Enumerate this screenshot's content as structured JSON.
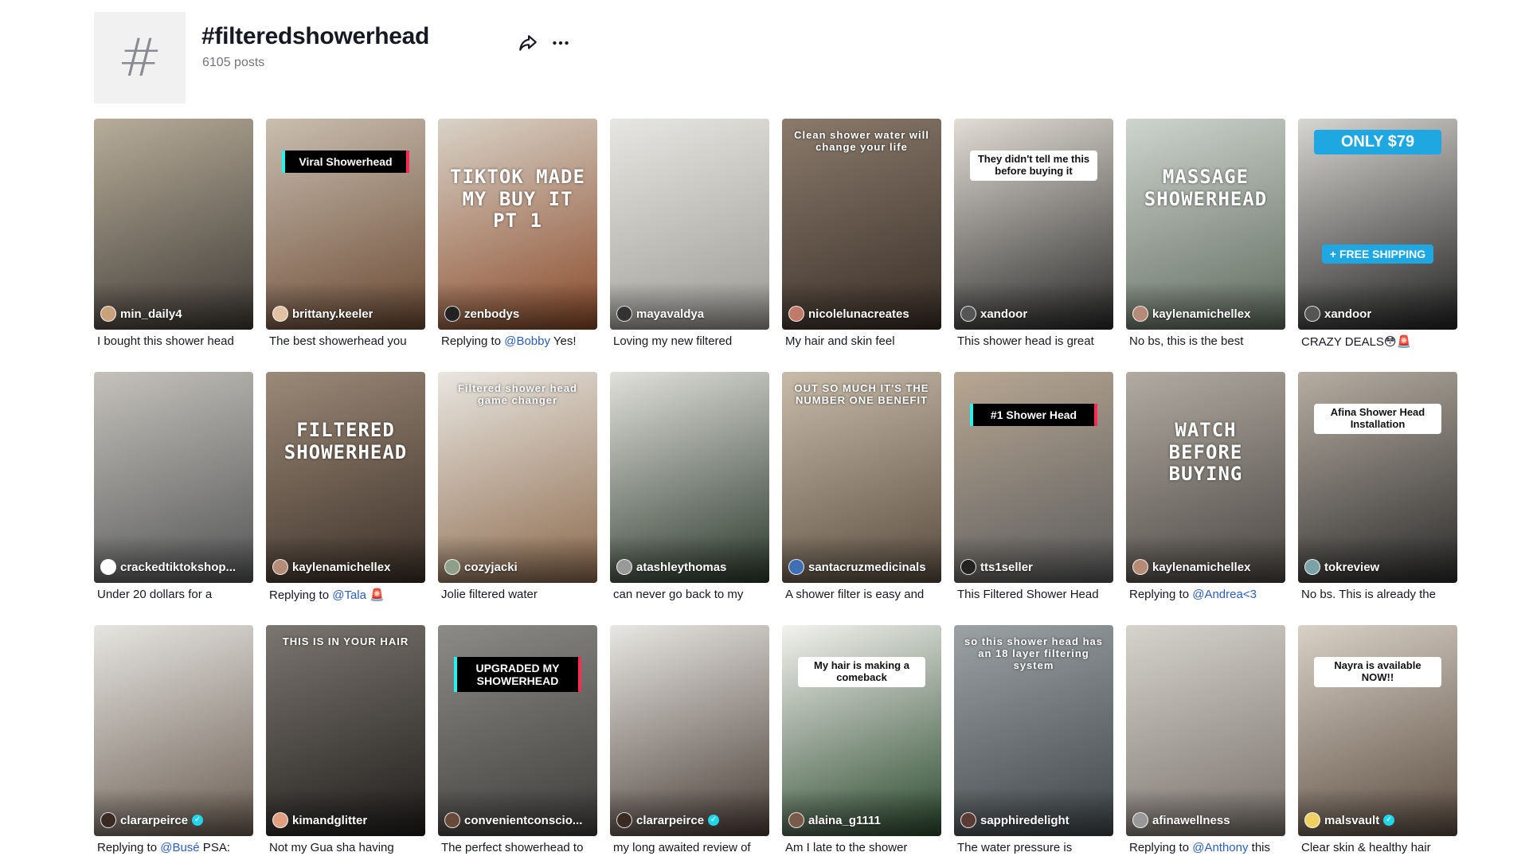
{
  "tag": {
    "icon": "hashtag-icon",
    "title": "#filteredshowerhead",
    "posts": "6105 posts"
  },
  "actions": {
    "share_icon": "share-icon",
    "more_icon": "more-icon"
  },
  "videos": [
    {
      "author": "min_daily4",
      "caption": "I bought this shower head",
      "colors": [
        "#b8ad9a",
        "#3f3a35"
      ],
      "avatar": "#c9a27b",
      "verified": false
    },
    {
      "author": "brittany.keeler",
      "caption": "The best showerhead you",
      "overlay": "Viral Showerhead",
      "colors": [
        "#c9beb0",
        "#6b4a34"
      ],
      "avatar": "#e3c1a5",
      "verified": false
    },
    {
      "author": "zenbodys",
      "caption_parts": [
        "Replying to ",
        "@Bobby",
        " Yes!"
      ],
      "overlay": "TIKTOK MADE MY BUY IT PT 1",
      "colors": [
        "#d9d3c8",
        "#8a4a2a"
      ],
      "avatar": "#222222",
      "verified": false
    },
    {
      "author": "mayavaldya",
      "caption": "Loving my new filtered",
      "colors": [
        "#e7e6e2",
        "#9c9a95"
      ],
      "avatar": "#333333",
      "verified": false
    },
    {
      "author": "nicolelunacreates",
      "caption": "My hair and skin feel",
      "overlay": "Clean shower water will change your life",
      "colors": [
        "#8a7b6c",
        "#3a2e27"
      ],
      "avatar": "#c07a6a",
      "verified": false
    },
    {
      "author": "xandoor",
      "caption": "This shower head is great",
      "overlay": "They didn't tell me this before buying it",
      "colors": [
        "#e2ddd5",
        "#2a2a2a"
      ],
      "avatar": "#555555",
      "verified": false
    },
    {
      "author": "kaylenamichellex",
      "caption": "No bs, this is the best",
      "overlay": "MASSAGE SHOWERHEAD",
      "colors": [
        "#cfd4cf",
        "#5f6b5d"
      ],
      "avatar": "#b58b78",
      "verified": false
    },
    {
      "author": "xandoor",
      "caption": "CRAZY DEALS😳🚨",
      "overlay": "ONLY $79",
      "overlay2": "+ FREE SHIPPING",
      "colors": [
        "#d8d6d2",
        "#222222"
      ],
      "avatar": "#555555",
      "verified": false
    },
    {
      "author": "crackedtiktokshop...",
      "caption": "Under 20 dollars for a",
      "colors": [
        "#c5c2bc",
        "#545556"
      ],
      "avatar": "#ffffff",
      "verified": false
    },
    {
      "author": "kaylenamichellex",
      "caption_parts": [
        "Replying to ",
        "@Tala",
        " 🚨"
      ],
      "overlay": "FILTERED SHOWERHEAD",
      "colors": [
        "#9c8a78",
        "#3b2f27"
      ],
      "avatar": "#b58b78",
      "verified": false
    },
    {
      "author": "cozyjacki",
      "caption": "Jolie filtered water",
      "overlay": "Filtered shower head game changer",
      "colors": [
        "#e9e6e0",
        "#8c6a4d"
      ],
      "avatar": "#8fa08a",
      "verified": false
    },
    {
      "author": "atashleythomas",
      "caption": "can never go back to my",
      "colors": [
        "#e1e0dc",
        "#2c3a2c"
      ],
      "avatar": "#999999",
      "verified": false
    },
    {
      "author": "santacruzmedicinals",
      "caption": "A shower filter is easy and",
      "overlay": "OUT SO MUCH IT'S THE NUMBER ONE BENEFIT",
      "colors": [
        "#c8bba9",
        "#5a4d40"
      ],
      "avatar": "#3f6fb5",
      "verified": false
    },
    {
      "author": "tts1seller",
      "caption": "This Filtered Shower Head",
      "overlay": "#1 Shower Head",
      "colors": [
        "#b8a792",
        "#595a5c"
      ],
      "avatar": "#222222",
      "verified": false
    },
    {
      "author": "kaylenamichellex",
      "caption_parts": [
        "Replying to ",
        "@Andrea<3",
        ""
      ],
      "overlay": "WATCH BEFORE BUYING",
      "colors": [
        "#b2aba2",
        "#4a4642"
      ],
      "avatar": "#b58b78",
      "verified": false
    },
    {
      "author": "tokreview",
      "caption": "No bs. This is already the",
      "overlay": "Afina Shower Head Installation",
      "colors": [
        "#b7aea2",
        "#2b2b2b"
      ],
      "avatar": "#7aa3a8",
      "verified": false
    },
    {
      "author": "clararpeirce",
      "caption_parts": [
        "Replying to ",
        "@Busé",
        " PSA:"
      ],
      "colors": [
        "#e6e5e1",
        "#6b5d52"
      ],
      "avatar": "#3a2a22",
      "verified": true
    },
    {
      "author": "kimandglitter",
      "caption": "Not my Gua sha having",
      "overlay": "THIS IS IN YOUR HAIR",
      "colors": [
        "#7c7670",
        "#1f1d1b"
      ],
      "avatar": "#e0a080",
      "verified": false
    },
    {
      "author": "convenientconscio...",
      "caption": "The perfect showerhead to",
      "overlay": "UPGRADED MY SHOWERHEAD",
      "colors": [
        "#8d8b87",
        "#3f3d3b"
      ],
      "avatar": "#6a4a3a",
      "verified": false
    },
    {
      "author": "clararpeirce",
      "caption": "my long awaited review of",
      "colors": [
        "#e8e7e3",
        "#4b3e37"
      ],
      "avatar": "#3a2a22",
      "verified": true
    },
    {
      "author": "alaina_g1111",
      "caption": "Am I late to the shower",
      "overlay": "My hair is making a comeback",
      "colors": [
        "#f3f2ef",
        "#2c4a2e"
      ],
      "avatar": "#7a5a48",
      "verified": false
    },
    {
      "author": "sapphiredelight",
      "caption": "The water pressure is",
      "overlay": "so this shower head has an 18 layer filtering system",
      "colors": [
        "#9da2a5",
        "#3f4548"
      ],
      "avatar": "#5a3c34",
      "verified": false
    },
    {
      "author": "afinawellness",
      "caption_parts": [
        "Replying to ",
        "@Anthony",
        " this"
      ],
      "colors": [
        "#d6d3cd",
        "#777069"
      ],
      "avatar": "#999999",
      "verified": false
    },
    {
      "author": "malsvault",
      "caption": "Clear skin & healthy hair",
      "overlay": "Nayra is available NOW!!",
      "colors": [
        "#d9d1c6",
        "#5a4b40"
      ],
      "avatar": "#f0d060",
      "verified": true
    }
  ]
}
